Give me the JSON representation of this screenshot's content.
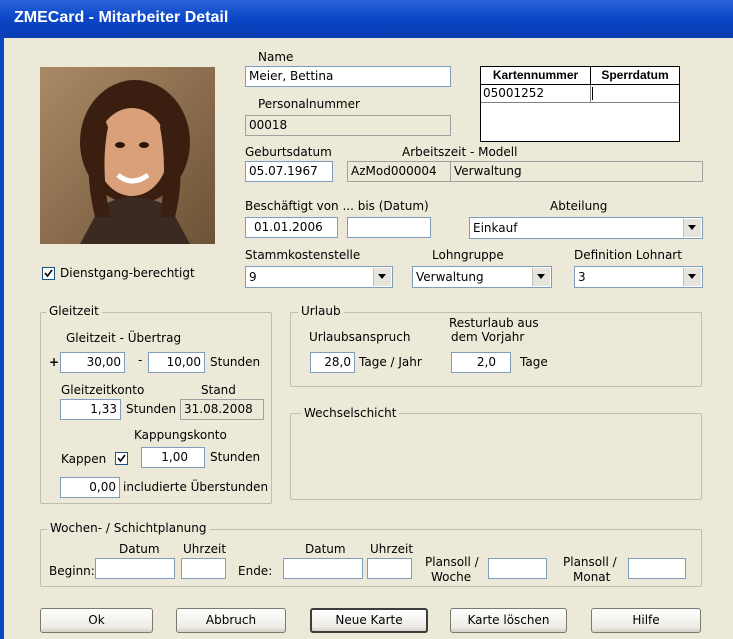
{
  "window": {
    "title": "ZMECard - Mitarbeiter Detail"
  },
  "photo": {
    "alt": "Mitarbeiterfoto",
    "icon": "person-photo"
  },
  "name": {
    "label": "Name",
    "value": "Meier, Bettina"
  },
  "personalnummer": {
    "label": "Personalnummer",
    "value": "00018"
  },
  "karten": {
    "headers": [
      "Kartennummer",
      "Sperrdatum"
    ],
    "rows": [
      [
        "05001252",
        ""
      ]
    ]
  },
  "geburtsdatum": {
    "label": "Geburtsdatum",
    "value": "05.07.1967"
  },
  "arbeitszeit": {
    "label": "Arbeitszeit - Modell",
    "code": "AzMod000004",
    "name": "Verwaltung"
  },
  "beschaeftigt": {
    "label": "Beschäftigt von ... bis (Datum)",
    "from": "01.01.2006",
    "to": ""
  },
  "abteilung": {
    "label": "Abteilung",
    "value": "Einkauf"
  },
  "dienstgang": {
    "label": "Dienstgang-berechtigt",
    "checked": true
  },
  "stammkostenstelle": {
    "label": "Stammkostenstelle",
    "value": "9"
  },
  "lohngruppe": {
    "label": "Lohngruppe",
    "value": "Verwaltung"
  },
  "lohnart": {
    "label": "Definition Lohnart",
    "value": "3"
  },
  "gleitzeit": {
    "title": "Gleitzeit",
    "uebertrag_label": "Gleitzeit - Übertrag",
    "plus_sign": "+",
    "plus_value": "30,00",
    "minus_sign": "-",
    "minus_value": "10,00",
    "stunden": "Stunden",
    "konto_label": "Gleitzeitkonto",
    "konto_value": "1,33",
    "konto_unit": "Stunden",
    "stand_label": "Stand",
    "stand_value": "31.08.2008",
    "kappung_label": "Kappungskonto",
    "kappen_label": "Kappen",
    "kappen_checked": true,
    "kappung_value": "1,00",
    "kappung_unit": "Stunden",
    "ueberstunden_value": "0,00",
    "ueberstunden_label": "includierte Überstunden"
  },
  "urlaub": {
    "title": "Urlaub",
    "anspruch_label": "Urlaubsanspruch",
    "anspruch_value": "28,0",
    "anspruch_unit": "Tage / Jahr",
    "rest_label1": "Resturlaub aus",
    "rest_label2": "dem Vorjahr",
    "rest_value": "2,0",
    "rest_unit": "Tage"
  },
  "wechselschicht": {
    "title": "Wechselschicht"
  },
  "planung": {
    "title": "Wochen- / Schichtplanung",
    "datum": "Datum",
    "uhrzeit": "Uhrzeit",
    "beginn": "Beginn:",
    "ende": "Ende:",
    "beginn_datum": "",
    "beginn_uhrzeit": "",
    "ende_datum": "",
    "ende_uhrzeit": "",
    "plansoll_woche1": "Plansoll /",
    "plansoll_woche2": "Woche",
    "plansoll_woche_value": "",
    "plansoll_monat1": "Plansoll /",
    "plansoll_monat2": "Monat",
    "plansoll_monat_value": ""
  },
  "buttons": {
    "ok": "Ok",
    "abbruch": "Abbruch",
    "neue_karte": "Neue Karte",
    "karte_loeschen": "Karte löschen",
    "hilfe": "Hilfe"
  }
}
